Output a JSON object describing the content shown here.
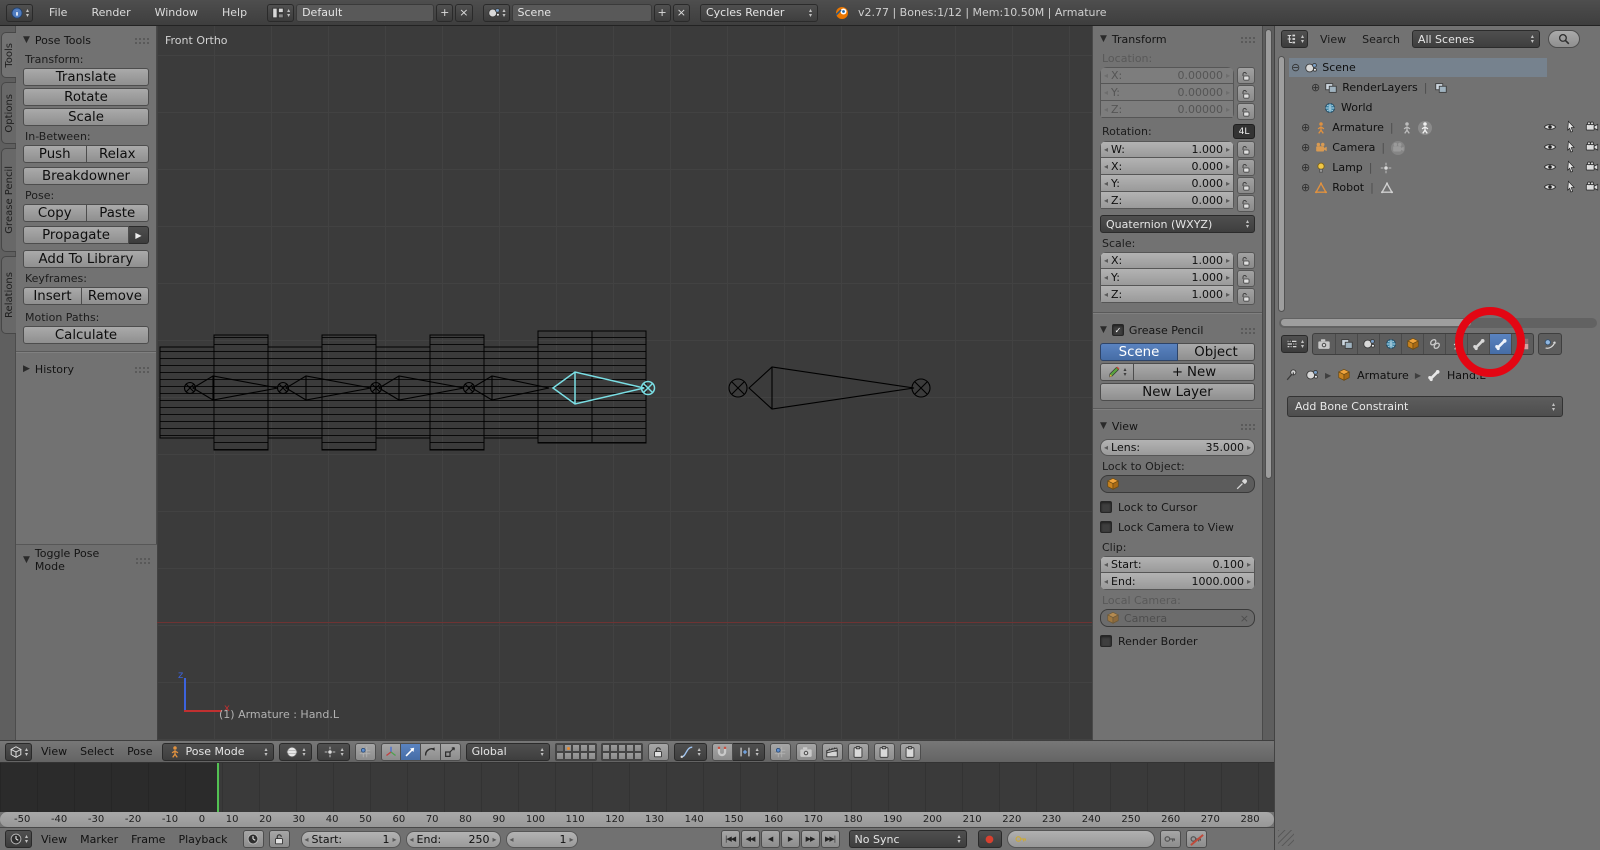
{
  "header": {
    "menus": [
      "File",
      "Render",
      "Window",
      "Help"
    ],
    "layout_value": "Default",
    "scene_value": "Scene",
    "engine_value": "Cycles Render",
    "stats": "v2.77 | Bones:1/12 | Mem:10.50M | Armature"
  },
  "tool_shelf": {
    "tabs": [
      "Tools",
      "Options",
      "Grease Pencil",
      "Relations"
    ],
    "pose_tools_title": "Pose Tools",
    "transform_label": "Transform:",
    "translate": "Translate",
    "rotate": "Rotate",
    "scale": "Scale",
    "in_between_label": "In-Between:",
    "push": "Push",
    "relax": "Relax",
    "breakdowner": "Breakdowner",
    "pose_label": "Pose:",
    "copy": "Copy",
    "paste": "Paste",
    "propagate": "Propagate",
    "add_to_library": "Add To Library",
    "keyframes_label": "Keyframes:",
    "insert": "Insert",
    "remove": "Remove",
    "motion_paths_label": "Motion Paths:",
    "calculate": "Calculate",
    "history_title": "History",
    "toggle_pose_title": "Toggle Pose Mode"
  },
  "viewport": {
    "view_label": "Front Ortho",
    "status": "(1) Armature : Hand.L",
    "axis_x_label": "x",
    "axis_z_label": "z"
  },
  "n_panel": {
    "transform_title": "Transform",
    "location_label": "Location:",
    "loc": [
      {
        "l": "X:",
        "v": "0.00000"
      },
      {
        "l": "Y:",
        "v": "0.00000"
      },
      {
        "l": "Z:",
        "v": "0.00000"
      }
    ],
    "rotation_label": "Rotation:",
    "rot_lock_badge": "4L",
    "rot": [
      {
        "l": "W:",
        "v": "1.000"
      },
      {
        "l": "X:",
        "v": "0.000"
      },
      {
        "l": "Y:",
        "v": "0.000"
      },
      {
        "l": "Z:",
        "v": "0.000"
      }
    ],
    "rotation_mode": "Quaternion (WXYZ)",
    "scale_label": "Scale:",
    "scl": [
      {
        "l": "X:",
        "v": "1.000"
      },
      {
        "l": "Y:",
        "v": "1.000"
      },
      {
        "l": "Z:",
        "v": "1.000"
      }
    ],
    "grease_title": "Grease Pencil",
    "gp_scene": "Scene",
    "gp_object": "Object",
    "gp_new": "New",
    "gp_new_layer": "New Layer",
    "view_title": "View",
    "lens_label": "Lens:",
    "lens_value": "35.000",
    "lock_to_object_label": "Lock to Object:",
    "lock_to_cursor": "Lock to Cursor",
    "lock_camera_to_view": "Lock Camera to View",
    "clip_label": "Clip:",
    "clip_start_label": "Start:",
    "clip_start": "0.100",
    "clip_end_label": "End:",
    "clip_end": "1000.000",
    "local_camera_label": "Local Camera:",
    "local_camera_value": "Camera",
    "render_border": "Render Border"
  },
  "outliner": {
    "menus": [
      "View",
      "Search"
    ],
    "filter_value": "All Scenes",
    "items": [
      {
        "label": "Scene"
      },
      {
        "label": "RenderLayers"
      },
      {
        "label": "World"
      },
      {
        "label": "Armature"
      },
      {
        "label": "Camera"
      },
      {
        "label": "Lamp"
      },
      {
        "label": "Robot"
      }
    ]
  },
  "properties": {
    "breadcrumb_object": "Armature",
    "breadcrumb_bone": "Hand.L",
    "add_constraint": "Add Bone Constraint"
  },
  "view3d_header": {
    "menus": [
      "View",
      "Select",
      "Pose"
    ],
    "mode_value": "Pose Mode",
    "orientation_value": "Global"
  },
  "timeline": {
    "menus": [
      "View",
      "Marker",
      "Frame",
      "Playback"
    ],
    "start_label": "Start:",
    "start_value": "1",
    "end_label": "End:",
    "end_value": "250",
    "frame_value": "1",
    "sync_value": "No Sync",
    "ruler": [
      "-50",
      "-40",
      "-30",
      "-20",
      "-10",
      "0",
      "10",
      "20",
      "30",
      "40",
      "50",
      "60",
      "70",
      "80",
      "90",
      "100",
      "110",
      "120",
      "130",
      "140",
      "150",
      "160",
      "170",
      "180",
      "190",
      "200",
      "210",
      "220",
      "230",
      "240",
      "250",
      "260",
      "270",
      "280"
    ]
  },
  "icons": {
    "collapse": "▼",
    "expand": "▶",
    "close": "×",
    "add": "+",
    "up": "▴",
    "down": "▾",
    "left": "◂",
    "right": "▸",
    "tree_open": "⊖",
    "tree_closed": "⊕",
    "check": "✓",
    "record_dot": "●",
    "jump_start": "|◀◀",
    "prev_key": "◀◀",
    "play_reverse": "◀",
    "play": "▶",
    "next_key": "▶▶",
    "jump_end": "▶▶|"
  }
}
